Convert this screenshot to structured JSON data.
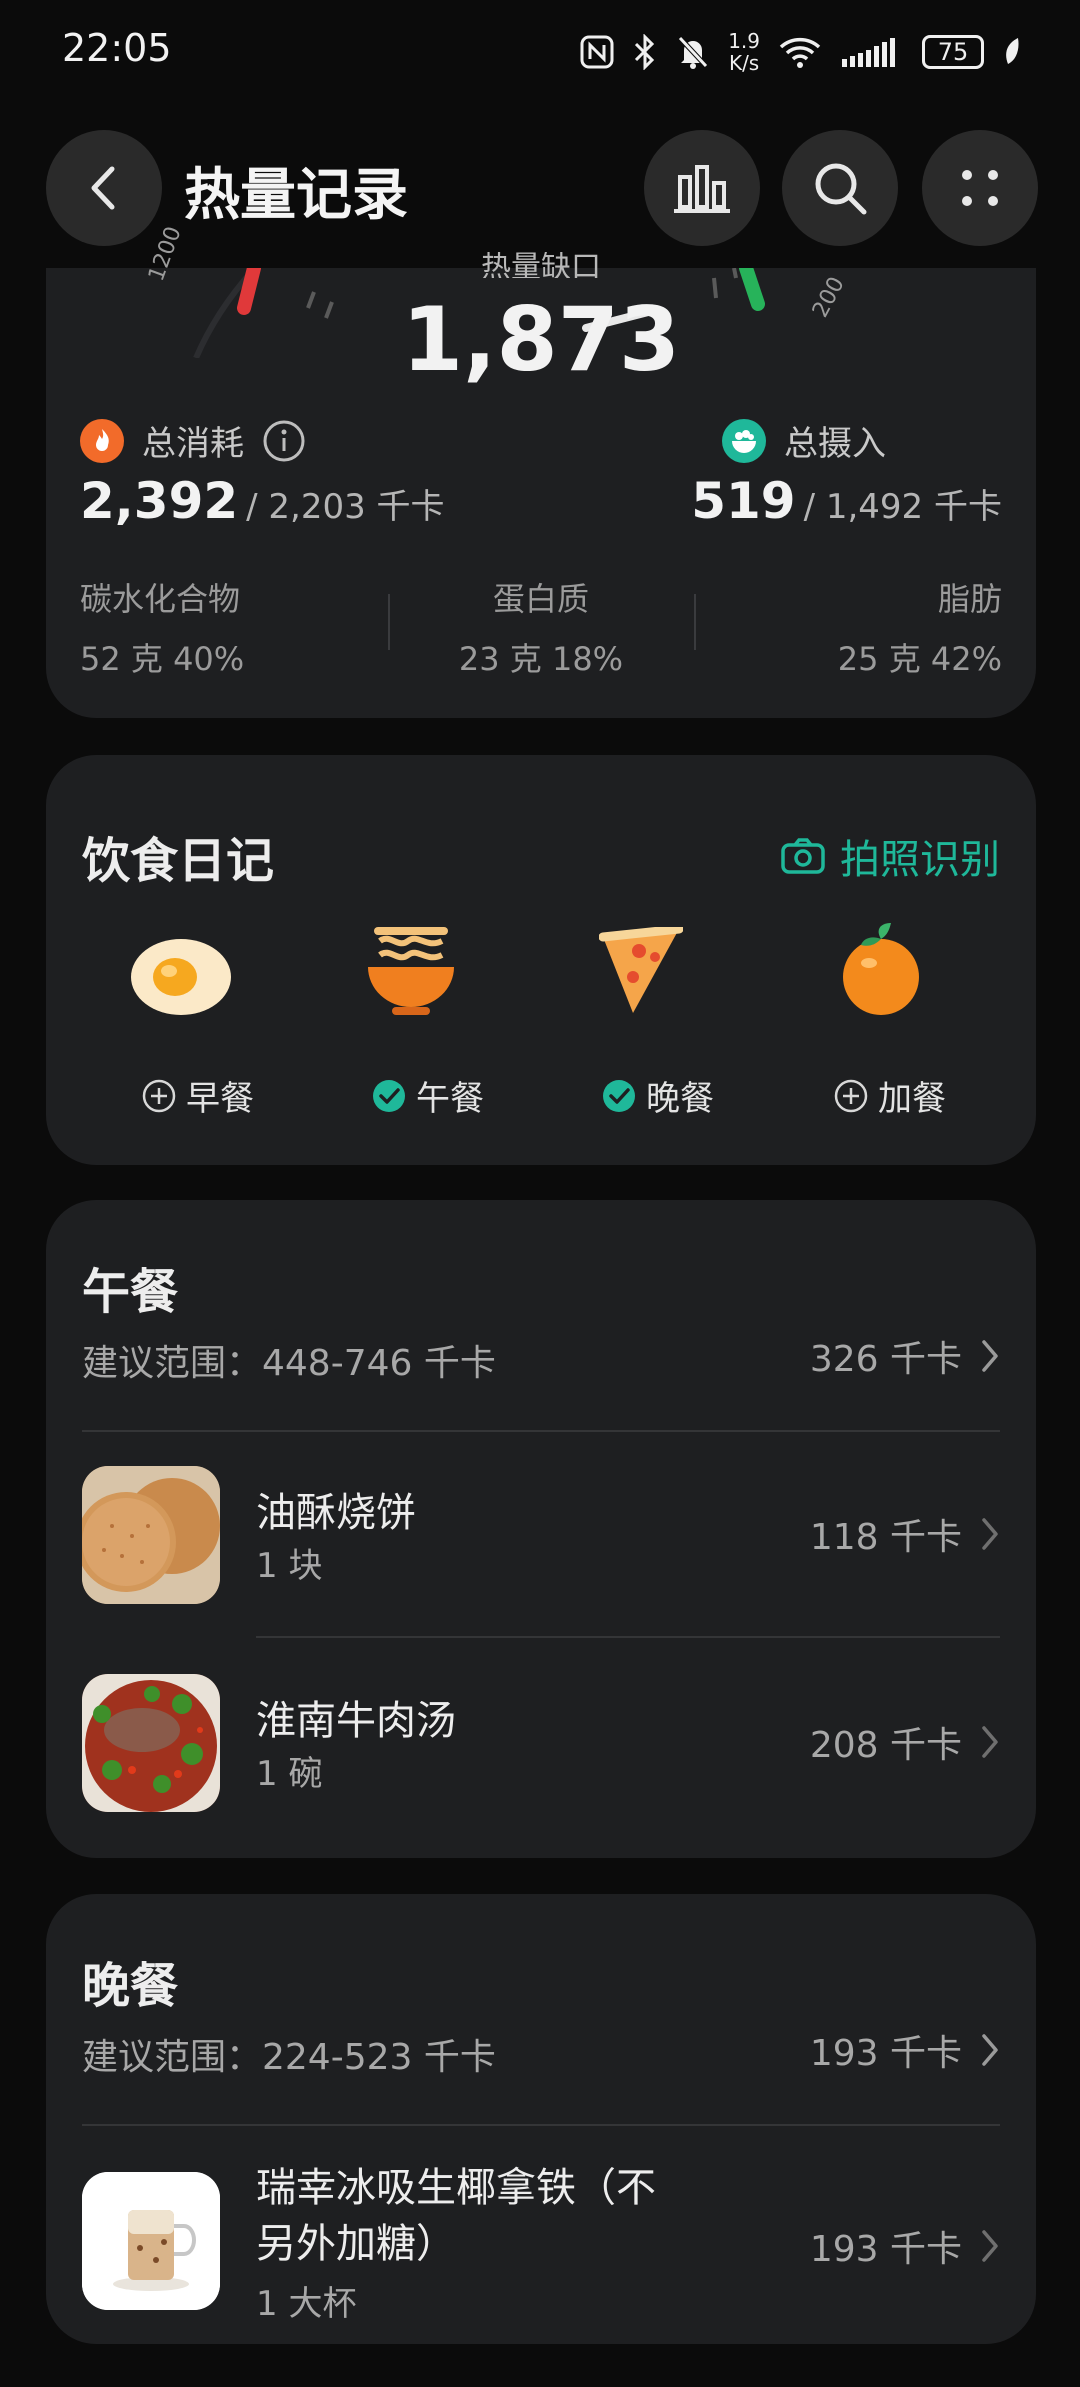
{
  "status_bar": {
    "time": "22:05",
    "net_speed_top": "1.9",
    "net_speed_bottom": "K/s",
    "battery": "75",
    "icons": [
      "nfc-icon",
      "bluetooth-icon",
      "mute-bell-icon",
      "wifi-icon",
      "signal-icon",
      "battery-icon",
      "leaf-icon"
    ]
  },
  "header": {
    "title": "热量记录",
    "back_icon": "chevron-left-icon",
    "actions": [
      "bar-chart-icon",
      "search-icon",
      "more-dots-icon"
    ]
  },
  "summary": {
    "gauge_label": "热量缺口",
    "gauge_value": "1,873",
    "gauge_tick_left": "1200",
    "gauge_tick_right": "200",
    "burn": {
      "label": "总消耗",
      "value": "2,392",
      "target": "/ 2,203 千卡"
    },
    "intake": {
      "label": "总摄入",
      "value": "519",
      "target": "/ 1,492 千卡"
    },
    "macros": [
      {
        "name": "碳水化合物",
        "detail": "52 克  40%"
      },
      {
        "name": "蛋白质",
        "detail": "23 克  18%"
      },
      {
        "name": "脂肪",
        "detail": "25 克  42%"
      }
    ]
  },
  "diary": {
    "title": "饮食日记",
    "photo_action": "拍照识别",
    "accent": "#1fb89a",
    "meals": [
      {
        "label": "早餐",
        "state": "add",
        "icon": "egg-icon"
      },
      {
        "label": "午餐",
        "state": "done",
        "icon": "noodle-bowl-icon"
      },
      {
        "label": "晚餐",
        "state": "done",
        "icon": "pizza-icon"
      },
      {
        "label": "加餐",
        "state": "add",
        "icon": "orange-icon"
      }
    ]
  },
  "lunch": {
    "title": "午餐",
    "range": "建议范围：448-746 千卡",
    "total": "326 千卡",
    "items": [
      {
        "name": "油酥烧饼",
        "qty": "1 块",
        "kcal": "118 千卡"
      },
      {
        "name": "淮南牛肉汤",
        "qty": "1 碗",
        "kcal": "208 千卡"
      }
    ]
  },
  "dinner": {
    "title": "晚餐",
    "range": "建议范围：224-523 千卡",
    "total": "193 千卡",
    "items": [
      {
        "name_line1": "瑞幸冰吸生椰拿铁（不",
        "name_line2": "另外加糖）",
        "qty": "1 大杯",
        "kcal": "193 千卡"
      }
    ]
  }
}
